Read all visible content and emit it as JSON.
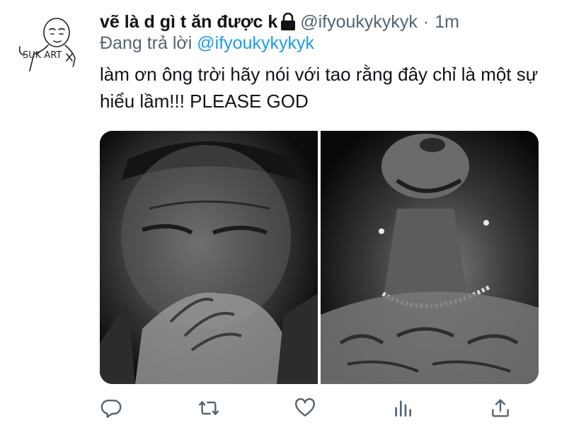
{
  "tweet": {
    "author": {
      "display_name": "vẽ là d gì t ăn được k",
      "handle": "@ifyoukykykyk",
      "avatar_text": "SUK ART"
    },
    "separator": "·",
    "time": "1m",
    "reply_prefix": "Đang trả lời",
    "reply_handle": "@ifyoukykykyk",
    "text": "làm ơn ông trời hãy nói với tao rằng đây chỉ là một sự hiểu lầm!!! PLEASE GOD",
    "media": {
      "count": 2
    },
    "actions": [
      {
        "name": "reply",
        "icon": "reply-icon"
      },
      {
        "name": "retweet",
        "icon": "retweet-icon"
      },
      {
        "name": "like",
        "icon": "heart-icon"
      },
      {
        "name": "analytics",
        "icon": "analytics-icon"
      },
      {
        "name": "share",
        "icon": "share-icon"
      }
    ],
    "colors": {
      "text": "#0f1419",
      "secondary": "#536471",
      "link": "#1d9bf0",
      "icon": "#536471"
    }
  }
}
